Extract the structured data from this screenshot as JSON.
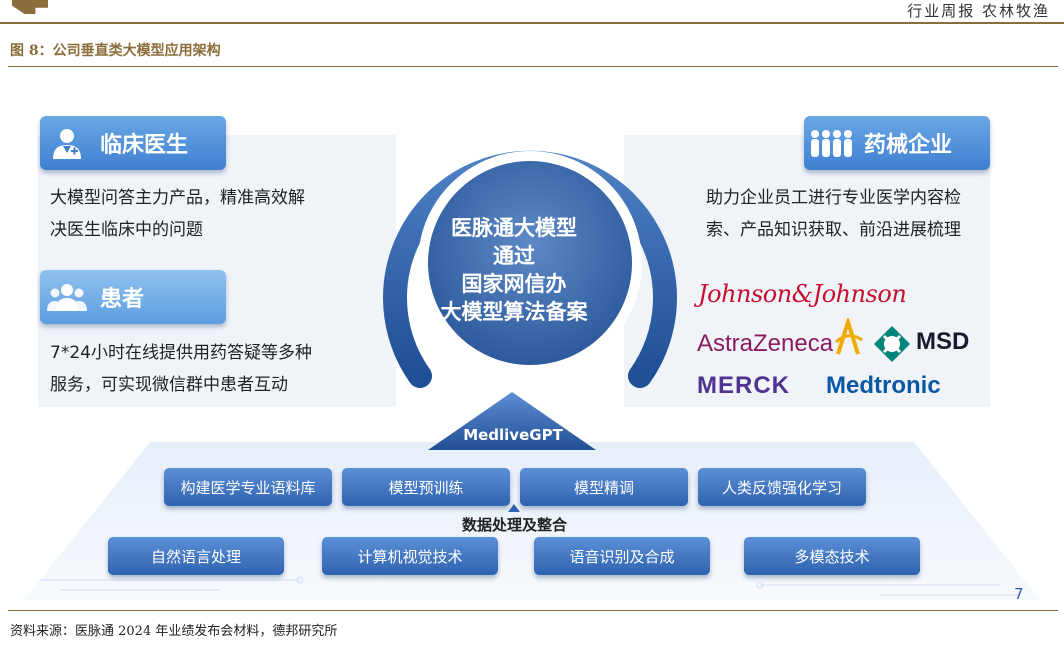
{
  "header": {
    "right_text": "行业周报  农林牧渔"
  },
  "figure": {
    "title": "图 8：公司垂直类大模型应用架构",
    "source": "资料来源：医脉通 2024 年业绩发布会材料，德邦研究所"
  },
  "diagram": {
    "center": {
      "lines": [
        "医脉通大模型",
        "通过",
        "国家网信办",
        "大模型算法备案"
      ]
    },
    "categories": {
      "doctor": {
        "label": "临床医生",
        "icon": "doctor-icon",
        "desc": [
          "大模型问答主力产品，精准高效解",
          "决医生临床中的问题"
        ]
      },
      "patient": {
        "label": "患者",
        "icon": "people-group-icon",
        "desc": [
          "7*24小时在线提供用药答疑等多种",
          "服务，可实现微信群中患者互动"
        ]
      },
      "pharma": {
        "label": "药械企业",
        "icon": "people-group-icon",
        "desc": [
          "助力企业员工进行专业医学内容检",
          "索、产品知识获取、前沿进展梳理"
        ]
      }
    },
    "logos": {
      "jj": "Johnson&Johnson",
      "az": "AstraZeneca",
      "msd": "MSD",
      "merck": "MERCK",
      "medtronic": "Medtronic"
    },
    "platform": {
      "model_name": "MedliveGPT",
      "merge_label": "数据处理及整合",
      "upper": [
        "构建医学专业语料库",
        "模型预训练",
        "模型精调",
        "人类反馈强化学习"
      ],
      "lower": [
        "自然语言处理",
        "计算机视觉技术",
        "语音识别及合成",
        "多模态技术"
      ]
    },
    "page_number": "7"
  },
  "colors": {
    "accent_brown": "#8a6d3b",
    "primary_blue": "#2f63b0",
    "light_blue": "#6aa8e6"
  }
}
